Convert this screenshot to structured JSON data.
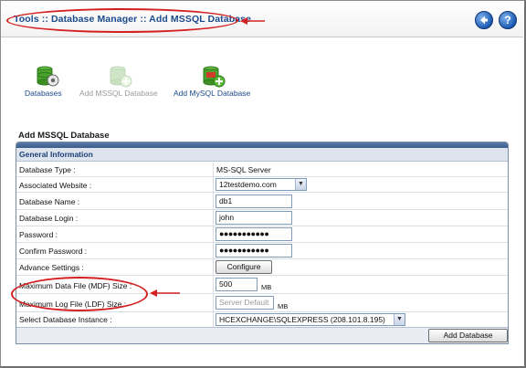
{
  "header": {
    "breadcrumb": "Tools :: Database Manager :: Add MSSQL Database",
    "back_icon": "back-arrow-icon",
    "help_icon": "help-icon",
    "help_glyph": "?",
    "back_glyph": "❮"
  },
  "nav": {
    "items": [
      {
        "label": "Databases",
        "icon": "databases-icon",
        "enabled": true
      },
      {
        "label": "Add MSSQL Database",
        "icon": "add-mssql-database-icon",
        "enabled": false
      },
      {
        "label": "Add MySQL Database",
        "icon": "add-mysql-database-icon",
        "enabled": true
      }
    ]
  },
  "form": {
    "title": "Add MSSQL Database",
    "section_header": "General Information",
    "fields": {
      "database_type": {
        "label": "Database Type :",
        "value": "MS-SQL Server"
      },
      "associated_website": {
        "label": "Associated Website :",
        "value": "12testdemo.com"
      },
      "database_name": {
        "label": "Database Name :",
        "value": "db1"
      },
      "database_login": {
        "label": "Database Login :",
        "value": "john"
      },
      "password": {
        "label": "Password :",
        "value": "●●●●●●●●●●●"
      },
      "confirm_password": {
        "label": "Confirm Password :",
        "value": "●●●●●●●●●●●"
      },
      "advance_settings": {
        "label": "Advance Settings :",
        "button": "Configure"
      },
      "max_data_file": {
        "label": "Maximum Data File (MDF) Size :",
        "value": "500",
        "unit": "MB"
      },
      "max_log_file": {
        "label": "Maximum Log File (LDF) Size :",
        "placeholder": "Server Default",
        "unit": "MB"
      },
      "db_instance": {
        "label": "Select Database Instance :",
        "value": "HCEXCHANGE\\SQLEXPRESS (208.101.8.195)"
      }
    },
    "submit": "Add Database"
  },
  "colors": {
    "link_blue": "#1b4a8c",
    "annotation_red": "#d42020",
    "panel_border": "#7a8ea8"
  }
}
